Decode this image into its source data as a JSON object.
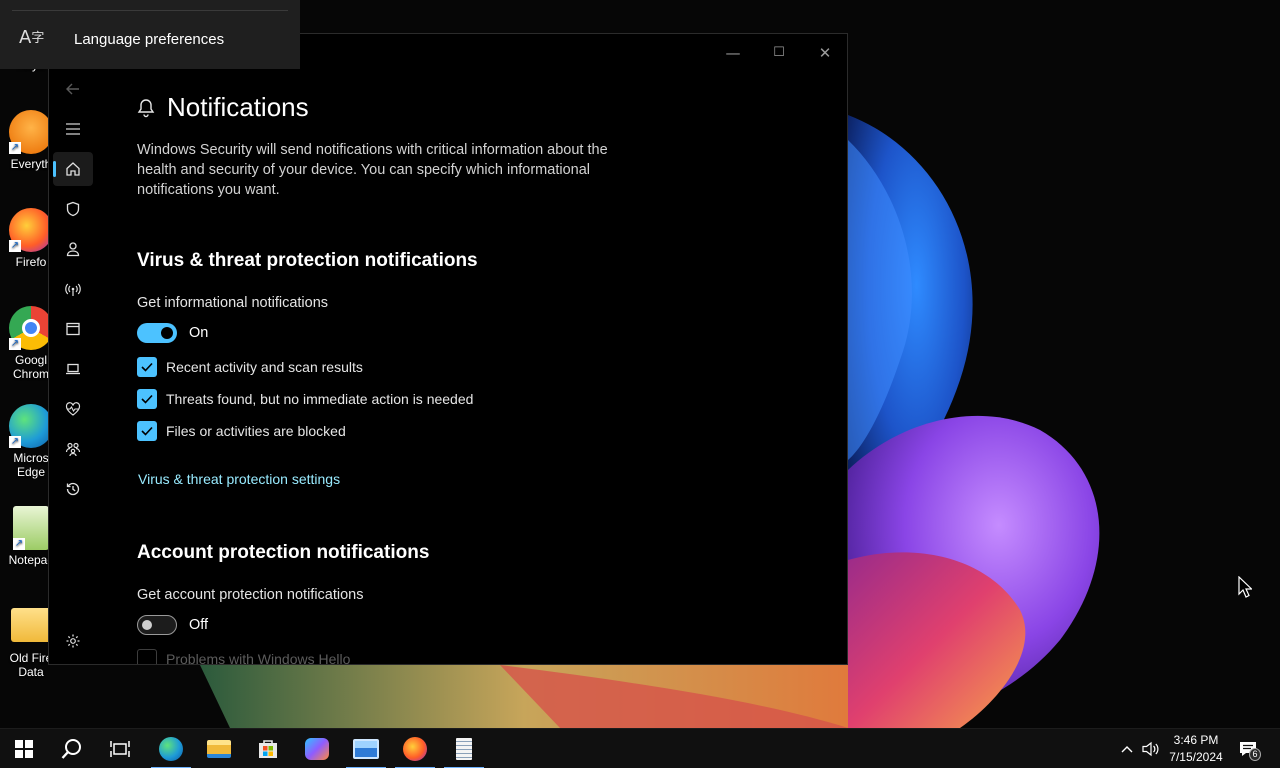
{
  "language_flyout": {
    "icon": "language-icon",
    "label": "Language preferences"
  },
  "desktop": {
    "icons": [
      {
        "label": "Keyb",
        "icon": "keyboard-shortcut-icon"
      },
      {
        "label": "Everyth",
        "icon": "everything-search-icon"
      },
      {
        "label": "Firefo",
        "icon": "firefox-icon"
      },
      {
        "label": "Googl\nChrom",
        "icon": "chrome-icon"
      },
      {
        "label": "Micros\nEdge",
        "icon": "edge-icon"
      },
      {
        "label": "Notepac",
        "icon": "notepad-plus-icon"
      },
      {
        "label": "Old Fire\nData",
        "icon": "folder-icon"
      }
    ]
  },
  "window": {
    "controls": {
      "minimize": "—",
      "maximize": "☐",
      "close": "✕"
    },
    "nav": [
      {
        "name": "back-icon",
        "active": false
      },
      {
        "name": "menu-icon",
        "active": false
      },
      {
        "name": "home-icon",
        "active": true
      },
      {
        "name": "shield-icon",
        "active": false
      },
      {
        "name": "account-icon",
        "active": false
      },
      {
        "name": "network-icon",
        "active": false
      },
      {
        "name": "app-browser-icon",
        "active": false
      },
      {
        "name": "device-security-icon",
        "active": false
      },
      {
        "name": "health-icon",
        "active": false
      },
      {
        "name": "family-icon",
        "active": false
      },
      {
        "name": "history-icon",
        "active": false
      },
      {
        "name": "settings-icon",
        "active": false
      }
    ],
    "page": {
      "title": "Notifications",
      "description": "Windows Security will send notifications with critical information about the health and security of your device. You can specify which informational notifications you want.",
      "virus_section": {
        "title": "Virus & threat protection notifications",
        "toggle_label": "Get informational notifications",
        "toggle_state": "On",
        "toggle_on": true,
        "checkboxes": [
          {
            "label": "Recent activity and scan results",
            "checked": true
          },
          {
            "label": "Threats found, but no immediate action is needed",
            "checked": true
          },
          {
            "label": "Files or activities are blocked",
            "checked": true
          }
        ],
        "settings_link": "Virus & threat protection settings"
      },
      "account_section": {
        "title": "Account protection notifications",
        "toggle_label": "Get account protection notifications",
        "toggle_state": "Off",
        "toggle_on": false,
        "checkboxes": [
          {
            "label": "Problems with Windows Hello",
            "checked": false,
            "disabled": true
          }
        ]
      }
    }
  },
  "taskbar": {
    "items": [
      "start-icon",
      "search-icon",
      "task-view-icon",
      "edge-icon",
      "file-explorer-icon",
      "store-icon",
      "copilot-icon",
      "photos-icon",
      "firefox-icon",
      "notepad-plus-icon"
    ],
    "time": "3:46 PM",
    "date": "7/15/2024",
    "notification_count": "6",
    "accent_color": "#4cc2ff"
  }
}
